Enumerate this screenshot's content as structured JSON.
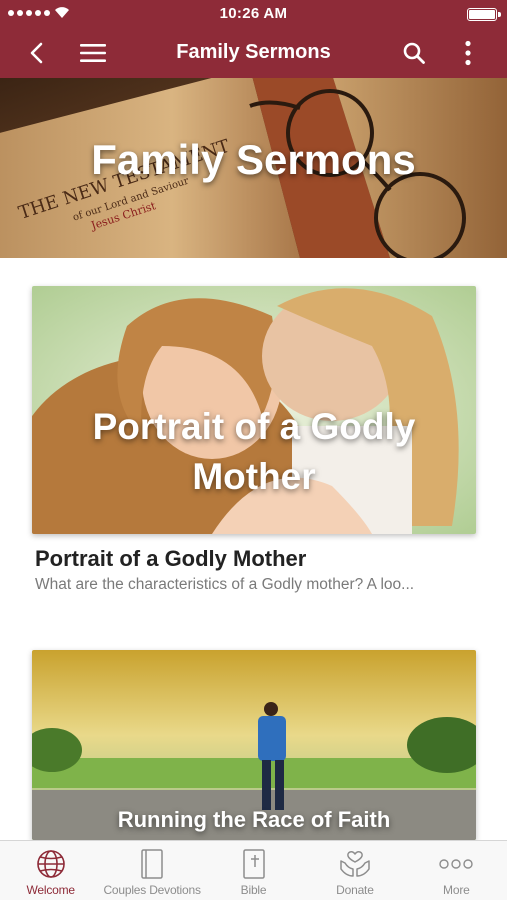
{
  "status_bar": {
    "time": "10:26 AM",
    "battery_level": 1.0
  },
  "nav": {
    "title": "Family Sermons",
    "icons": [
      "back-icon",
      "hamburger-menu-icon",
      "search-icon",
      "more-vertical-icon"
    ]
  },
  "banner": {
    "title": "Family Sermons",
    "image": "bible-and-glasses-photo",
    "book_text": [
      "THE NEW TESTAMENT",
      "of our Lord and Saviour",
      "Jesus Christ"
    ]
  },
  "cards": [
    {
      "overlay_title": "Portrait of a Godly Mother",
      "title": "Portrait of a Godly Mother",
      "description": "What are the characteristics of a Godly mother? A loo...",
      "image": "mother-and-daughter-photo"
    },
    {
      "overlay_title": "Running the Race of Faith",
      "image": "runner-on-road-photo"
    }
  ],
  "tabs": [
    {
      "label": "Welcome",
      "icon": "globe-icon",
      "active": true
    },
    {
      "label": "Couples Devotions",
      "icon": "book-icon",
      "active": false
    },
    {
      "label": "Bible",
      "icon": "bible-cross-icon",
      "active": false
    },
    {
      "label": "Donate",
      "icon": "giving-hands-icon",
      "active": false
    },
    {
      "label": "More",
      "icon": "more-dots-icon",
      "active": false
    }
  ],
  "colors": {
    "brand": "#8e2b38",
    "tab_inactive": "#8d8d8d",
    "tab_active": "#8e2b38"
  }
}
